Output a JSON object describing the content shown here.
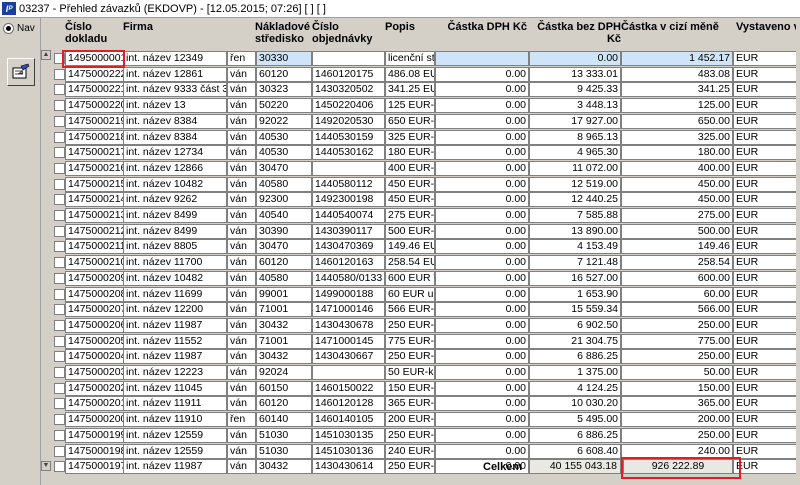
{
  "window": {
    "app_icon": "Iᴾ",
    "title": "03237 - Přehled závazků (EKDOVP) - [12.05.2015; 07:26] [ ] [ ]"
  },
  "nav": {
    "label": "Nav"
  },
  "toolbar": {
    "icon": "edit-document-icon"
  },
  "columns": {
    "doklad": "Číslo\ndokladu",
    "firma": "Firma",
    "stredisko": "Nákladové\nstředisko",
    "objednavka": "Číslo\nobjednávky",
    "popis": "Popis",
    "dph": "Částka DPH Kč",
    "bez_dph": "Částka bez DPH Kč",
    "cizi": "Částka v cizí měně",
    "vystaveno": "Vystaveno v"
  },
  "rows": [
    {
      "doklad": "1495000001",
      "firma": "int. název 12349",
      "k": "řen",
      "stredisko": "30330",
      "objednavka": "",
      "popis": "licenční stud",
      "dph": "",
      "bez_dph": "0.00",
      "cizi": "1 452.17",
      "mena": "EUR"
    },
    {
      "doklad": "1475000222",
      "firma": "int. název 12861",
      "k": "ván",
      "stredisko": "60120",
      "objednavka": "1460120175",
      "popis": "486.08 EUR-",
      "dph": "0.00",
      "bez_dph": "13 333.01",
      "cizi": "483.08",
      "mena": "EUR"
    },
    {
      "doklad": "1475000221",
      "firma": "int. název 9333 část 33",
      "k": "ván",
      "stredisko": "30323",
      "objednavka": "1430320502",
      "popis": "341.25 EUR-",
      "dph": "0.00",
      "bez_dph": "9 425.33",
      "cizi": "341.25",
      "mena": "EUR"
    },
    {
      "doklad": "1475000220",
      "firma": "int. název 13",
      "k": "ván",
      "stredisko": "50220",
      "objednavka": "1450220406",
      "popis": "125 EUR-ubj",
      "dph": "0.00",
      "bez_dph": "3 448.13",
      "cizi": "125.00",
      "mena": "EUR"
    },
    {
      "doklad": "1475000219",
      "firma": "int. název 8384",
      "k": "ván",
      "stredisko": "92022",
      "objednavka": "1492020530",
      "popis": "650 EUR-kor",
      "dph": "0.00",
      "bez_dph": "17 927.00",
      "cizi": "650.00",
      "mena": "EUR"
    },
    {
      "doklad": "1475000218",
      "firma": "int. název 8384",
      "k": "ván",
      "stredisko": "40530",
      "objednavka": "1440530159",
      "popis": "325 EUR-kor",
      "dph": "0.00",
      "bez_dph": "8 965.13",
      "cizi": "325.00",
      "mena": "EUR"
    },
    {
      "doklad": "1475000217",
      "firma": "int. název 12734",
      "k": "ván",
      "stredisko": "40530",
      "objednavka": "1440530162",
      "popis": "180 EUR-kor",
      "dph": "0.00",
      "bez_dph": "4 965.30",
      "cizi": "180.00",
      "mena": "EUR"
    },
    {
      "doklad": "1475000216",
      "firma": "int. název 12866",
      "k": "ván",
      "stredisko": "30470",
      "objednavka": "",
      "popis": "400 EUR-ch",
      "dph": "0.00",
      "bez_dph": "11 072.00",
      "cizi": "400.00",
      "mena": "EUR"
    },
    {
      "doklad": "1475000215",
      "firma": "int. název 10482",
      "k": "ván",
      "stredisko": "40580",
      "objednavka": "1440580112",
      "popis": "450 EUR-kor",
      "dph": "0.00",
      "bez_dph": "12 519.00",
      "cizi": "450.00",
      "mena": "EUR"
    },
    {
      "doklad": "1475000214",
      "firma": "int. název 9262",
      "k": "ván",
      "stredisko": "92300",
      "objednavka": "1492300198",
      "popis": "450 EUR-kor",
      "dph": "0.00",
      "bez_dph": "12 440.25",
      "cizi": "450.00",
      "mena": "EUR"
    },
    {
      "doklad": "1475000213",
      "firma": "int. název 8499",
      "k": "ván",
      "stredisko": "40540",
      "objednavka": "1440540074",
      "popis": "275 EUR-kor",
      "dph": "0.00",
      "bez_dph": "7 585.88",
      "cizi": "275.00",
      "mena": "EUR"
    },
    {
      "doklad": "1475000212",
      "firma": "int. název 8499",
      "k": "ván",
      "stredisko": "30390",
      "objednavka": "1430390117",
      "popis": "500 EUR-kor",
      "dph": "0.00",
      "bez_dph": "13 890.00",
      "cizi": "500.00",
      "mena": "EUR"
    },
    {
      "doklad": "1475000211",
      "firma": "int. název 8805",
      "k": "ván",
      "stredisko": "30470",
      "objednavka": "1430470369",
      "popis": "149.46 EUR",
      "dph": "0.00",
      "bez_dph": "4 153.49",
      "cizi": "149.46",
      "mena": "EUR"
    },
    {
      "doklad": "1475000210",
      "firma": "int. název 11700",
      "k": "ván",
      "stredisko": "60120",
      "objednavka": "1460120163",
      "popis": "258.54 EUR",
      "dph": "0.00",
      "bez_dph": "7 121.48",
      "cizi": "258.54",
      "mena": "EUR"
    },
    {
      "doklad": "1475000209",
      "firma": "int. název 10482",
      "k": "ván",
      "stredisko": "40580",
      "objednavka": "1440580/0133",
      "popis": "600 EUR WS",
      "dph": "0.00",
      "bez_dph": "16 527.00",
      "cizi": "600.00",
      "mena": "EUR"
    },
    {
      "doklad": "1475000208",
      "firma": "int. název 11699",
      "k": "ván",
      "stredisko": "99001",
      "objednavka": "1499000188",
      "popis": "60 EUR ubyt",
      "dph": "0.00",
      "bez_dph": "1 653.90",
      "cizi": "60.00",
      "mena": "EUR"
    },
    {
      "doklad": "1475000207",
      "firma": "int. název 12200",
      "k": "ván",
      "stredisko": "71001",
      "objednavka": "1471000146",
      "popis": "566 EUR-ubj",
      "dph": "0.00",
      "bez_dph": "15 559.34",
      "cizi": "566.00",
      "mena": "EUR"
    },
    {
      "doklad": "1475000206",
      "firma": "int. název 11987",
      "k": "ván",
      "stredisko": "30432",
      "objednavka": "1430430678",
      "popis": "250 EUR-kor",
      "dph": "0.00",
      "bez_dph": "6 902.50",
      "cizi": "250.00",
      "mena": "EUR"
    },
    {
      "doklad": "1475000205",
      "firma": "int. název 11552",
      "k": "ván",
      "stredisko": "71001",
      "objednavka": "1471000145",
      "popis": "775 EUR-kor",
      "dph": "0.00",
      "bez_dph": "21 304.75",
      "cizi": "775.00",
      "mena": "EUR"
    },
    {
      "doklad": "1475000204",
      "firma": "int. název 11987",
      "k": "ván",
      "stredisko": "30432",
      "objednavka": "1430430667",
      "popis": "250 EUR-kor",
      "dph": "0.00",
      "bez_dph": "6 886.25",
      "cizi": "250.00",
      "mena": "EUR"
    },
    {
      "doklad": "1475000203",
      "firma": "int. název 12223",
      "k": "ván",
      "stredisko": "92024",
      "objednavka": "",
      "popis": "50 EUR-kon",
      "dph": "0.00",
      "bez_dph": "1 375.00",
      "cizi": "50.00",
      "mena": "EUR"
    },
    {
      "doklad": "1475000202",
      "firma": "int. název 11045",
      "k": "ván",
      "stredisko": "60150",
      "objednavka": "1460150022",
      "popis": "150 EUR-ko",
      "dph": "0.00",
      "bez_dph": "4 124.25",
      "cizi": "150.00",
      "mena": "EUR"
    },
    {
      "doklad": "1475000201",
      "firma": "int. název 11911",
      "k": "ván",
      "stredisko": "60120",
      "objednavka": "1460120128",
      "popis": "365 EUR-kko",
      "dph": "0.00",
      "bez_dph": "10 030.20",
      "cizi": "365.00",
      "mena": "EUR"
    },
    {
      "doklad": "1475000200",
      "firma": "int. název 11910",
      "k": "řen",
      "stredisko": "60140",
      "objednavka": "1460140105",
      "popis": "200 EUR-ubj",
      "dph": "0.00",
      "bez_dph": "5 495.00",
      "cizi": "200.00",
      "mena": "EUR"
    },
    {
      "doklad": "1475000199",
      "firma": "int. název 12559",
      "k": "ván",
      "stredisko": "51030",
      "objednavka": "1451030135",
      "popis": "250 EUR-kor",
      "dph": "0.00",
      "bez_dph": "6 886.25",
      "cizi": "250.00",
      "mena": "EUR"
    },
    {
      "doklad": "1475000198",
      "firma": "int. název 12559",
      "k": "ván",
      "stredisko": "51030",
      "objednavka": "1451030136",
      "popis": "240 EUR-kor",
      "dph": "0.00",
      "bez_dph": "6 608.40",
      "cizi": "240.00",
      "mena": "EUR"
    },
    {
      "doklad": "1475000197",
      "firma": "int. název 11987",
      "k": "ván",
      "stredisko": "30432",
      "objednavka": "1430430614",
      "popis": "250 EUR-kor",
      "dph": "0.00",
      "bez_dph": "6 875.00",
      "cizi": "250.00",
      "mena": "EUR"
    }
  ],
  "footer": {
    "label": "Celkem",
    "total_bez_dph": "40 155 043.18",
    "total_cizi": "926 222.89"
  },
  "colors": {
    "highlight": "#e02020",
    "selected_row": "#cfe4f6"
  }
}
